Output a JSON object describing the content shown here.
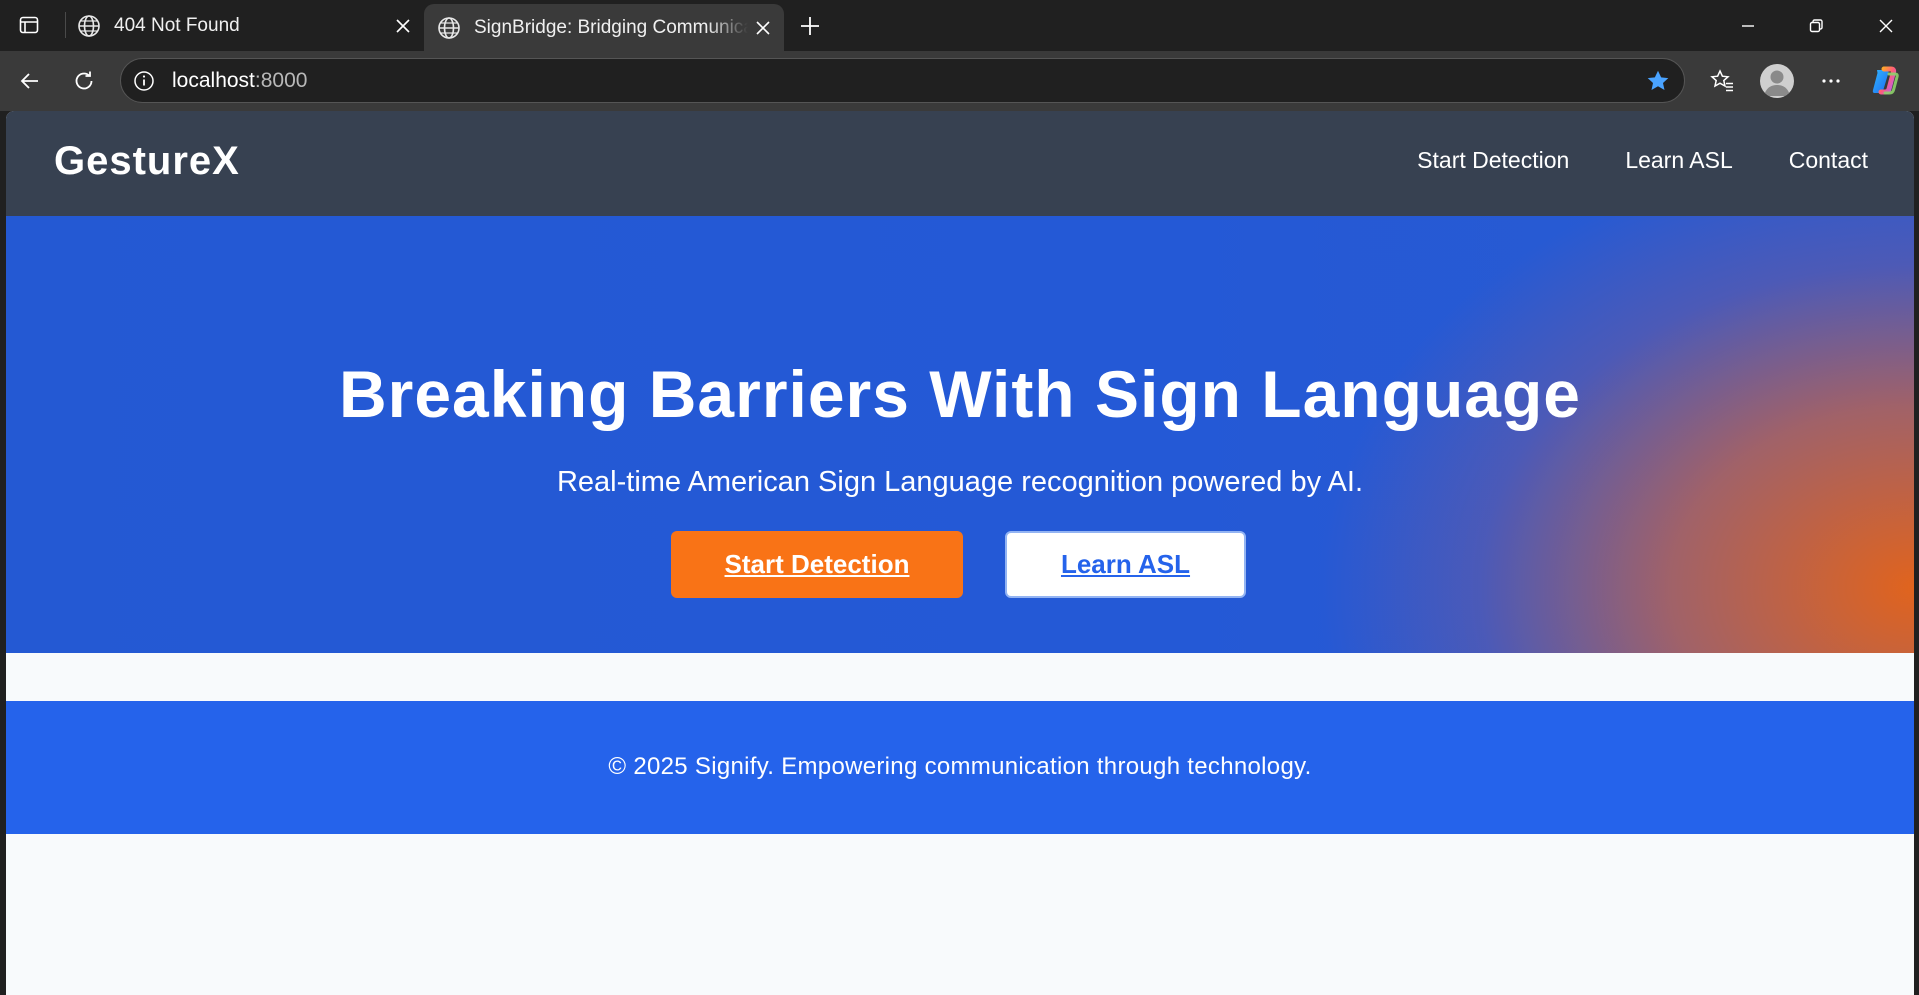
{
  "browser": {
    "tabs": [
      {
        "title": "404 Not Found",
        "active": false
      },
      {
        "title": "SignBridge: Bridging Communication",
        "active": true
      }
    ],
    "address": {
      "host": "localhost",
      "port": ":8000"
    }
  },
  "site": {
    "brand": "GestureX",
    "nav": [
      "Start Detection",
      "Learn ASL",
      "Contact"
    ],
    "hero": {
      "title": "Breaking Barriers With Sign Language",
      "subtitle": "Real-time American Sign Language recognition powered by AI.",
      "primary_cta": "Start Detection",
      "secondary_cta": "Learn ASL"
    },
    "footer": "© 2025 Signify. Empowering communication through technology."
  },
  "colors": {
    "nav_bg": "#374151",
    "hero_blue": "#2459d3",
    "hero_orange": "#ea6414",
    "primary_button": "#f97316",
    "footer_bg": "#2563eb",
    "favorite_star": "#4aa3ff"
  },
  "icons": [
    "tab-actions-icon",
    "globe-icon",
    "close-icon",
    "new-tab-icon",
    "minimize-icon",
    "restore-icon",
    "window-close-icon",
    "back-icon",
    "reload-icon",
    "info-icon",
    "star-icon",
    "favorites-icon",
    "profile-icon",
    "more-icon",
    "copilot-icon"
  ]
}
